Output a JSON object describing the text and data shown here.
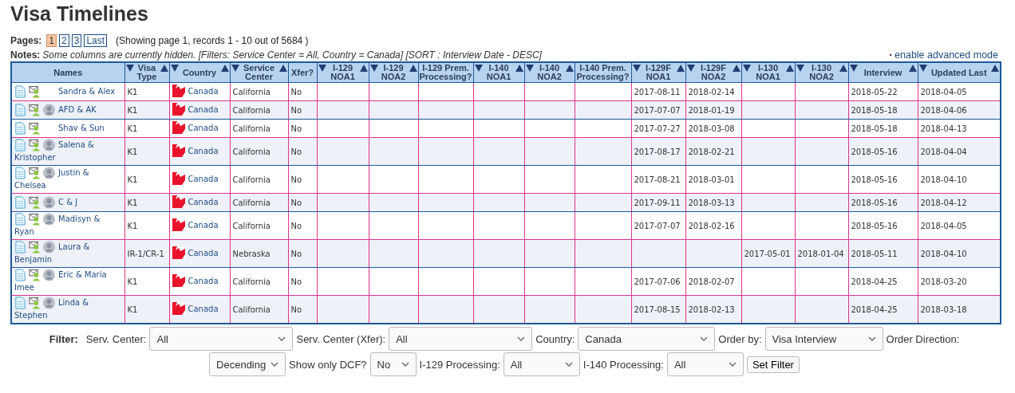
{
  "title": "Visa Timelines",
  "pager": {
    "label": "Pages:",
    "pages": [
      {
        "label": "1",
        "selected": true
      },
      {
        "label": "2",
        "selected": false
      },
      {
        "label": "3",
        "selected": false
      },
      {
        "label": "Last",
        "selected": false
      }
    ],
    "summary": "(Showing page 1, records 1 - 10 out of 5684 )"
  },
  "notes": {
    "label": "Notes:",
    "text": "Some columns are currently hidden. [Filters: Service Center = All, Country = Canada] [SORT : Interview Date - DESC]",
    "link": "enable advanced mode"
  },
  "table": {
    "columns": [
      {
        "label": "Names",
        "sortable": false
      },
      {
        "label": "Visa Type",
        "sortable": true
      },
      {
        "label": "Country",
        "sortable": true
      },
      {
        "label": "Service Center",
        "sortable": true
      },
      {
        "label": "Xfer?",
        "sortable": false
      },
      {
        "label": "I-129 NOA1",
        "sortable": true
      },
      {
        "label": "I-129 NOA2",
        "sortable": true
      },
      {
        "label": "I-129 Prem. Processing?",
        "sortable": false
      },
      {
        "label": "I-140 NOA1",
        "sortable": true
      },
      {
        "label": "I-140 NOA2",
        "sortable": true
      },
      {
        "label": "I-140 Prem. Processing?",
        "sortable": false
      },
      {
        "label": "I-129F NOA1",
        "sortable": true
      },
      {
        "label": "I-129F NOA2",
        "sortable": true
      },
      {
        "label": "I-130 NOA1",
        "sortable": true
      },
      {
        "label": "I-130 NOA2",
        "sortable": true
      },
      {
        "label": "Interview",
        "sortable": true
      },
      {
        "label": "Updated Last",
        "sortable": true
      }
    ],
    "rows": [
      {
        "avatar": false,
        "cells": [
          "Sandra & Alex",
          "K1",
          "Canada",
          "California",
          "No",
          "",
          "",
          "",
          "",
          "",
          "",
          "2017-08-11",
          "2018-02-14",
          "",
          "",
          "2018-05-22",
          "2018-04-05"
        ]
      },
      {
        "avatar": true,
        "cells": [
          "AFD & AK",
          "K1",
          "Canada",
          "California",
          "No",
          "",
          "",
          "",
          "",
          "",
          "",
          "2017-07-07",
          "2018-01-19",
          "",
          "",
          "2018-05-18",
          "2018-04-06"
        ]
      },
      {
        "avatar": false,
        "cells": [
          "Shav & Sun",
          "K1",
          "Canada",
          "California",
          "No",
          "",
          "",
          "",
          "",
          "",
          "",
          "2017-07-27",
          "2018-03-08",
          "",
          "",
          "2018-05-18",
          "2018-04-13"
        ]
      },
      {
        "avatar": true,
        "cells": [
          "Salena & Kristopher",
          "K1",
          "Canada",
          "California",
          "No",
          "",
          "",
          "",
          "",
          "",
          "",
          "2017-08-17",
          "2018-02-21",
          "",
          "",
          "2018-05-16",
          "2018-04-04"
        ]
      },
      {
        "avatar": true,
        "cells": [
          "Justin & Chelsea",
          "K1",
          "Canada",
          "California",
          "No",
          "",
          "",
          "",
          "",
          "",
          "",
          "2017-08-21",
          "2018-03-01",
          "",
          "",
          "2018-05-16",
          "2018-04-10"
        ]
      },
      {
        "avatar": true,
        "cells": [
          "C & J",
          "K1",
          "Canada",
          "California",
          "No",
          "",
          "",
          "",
          "",
          "",
          "",
          "2017-09-11",
          "2018-03-13",
          "",
          "",
          "2018-05-16",
          "2018-04-12"
        ]
      },
      {
        "avatar": true,
        "cells": [
          "Madisyn & Ryan",
          "K1",
          "Canada",
          "California",
          "No",
          "",
          "",
          "",
          "",
          "",
          "",
          "2017-07-07",
          "2018-02-16",
          "",
          "",
          "2018-05-16",
          "2018-04-05"
        ]
      },
      {
        "avatar": true,
        "cells": [
          "Laura & Benjamin",
          "IR-1/CR-1",
          "Canada",
          "Nebraska",
          "No",
          "",
          "",
          "",
          "",
          "",
          "",
          "",
          "",
          "2017-05-01",
          "2018-01-04",
          "2018-05-11",
          "2018-04-10"
        ]
      },
      {
        "avatar": true,
        "cells": [
          "Eric & Maria Imee",
          "K1",
          "Canada",
          "California",
          "No",
          "",
          "",
          "",
          "",
          "",
          "",
          "2017-07-06",
          "2018-02-07",
          "",
          "",
          "2018-04-25",
          "2018-03-20"
        ]
      },
      {
        "avatar": true,
        "cells": [
          "Linda & Stephen",
          "K1",
          "Canada",
          "California",
          "No",
          "",
          "",
          "",
          "",
          "",
          "",
          "2017-08-15",
          "2018-02-13",
          "",
          "",
          "2018-04-25",
          "2018-03-18"
        ]
      }
    ]
  },
  "filter": {
    "label": "Filter:",
    "fields": [
      {
        "kind": "select",
        "label": "Serv. Center:",
        "value": "All"
      },
      {
        "kind": "select",
        "label": "Serv. Center (Xfer):",
        "value": "All"
      },
      {
        "kind": "select",
        "label": "Country:",
        "value": "Canada"
      },
      {
        "kind": "select",
        "label": "Order by:",
        "value": "Visa Interview"
      },
      {
        "kind": "label",
        "label": "Order Direction:"
      },
      {
        "kind": "break"
      },
      {
        "kind": "select",
        "value": "Decending"
      },
      {
        "kind": "select",
        "label": "Show only DCF?",
        "value": "No"
      },
      {
        "kind": "select",
        "label": "I-129 Processing:",
        "value": "All"
      },
      {
        "kind": "select",
        "label": "I-140 Processing:",
        "value": "All"
      },
      {
        "kind": "button",
        "label": "Set Filter"
      }
    ]
  }
}
